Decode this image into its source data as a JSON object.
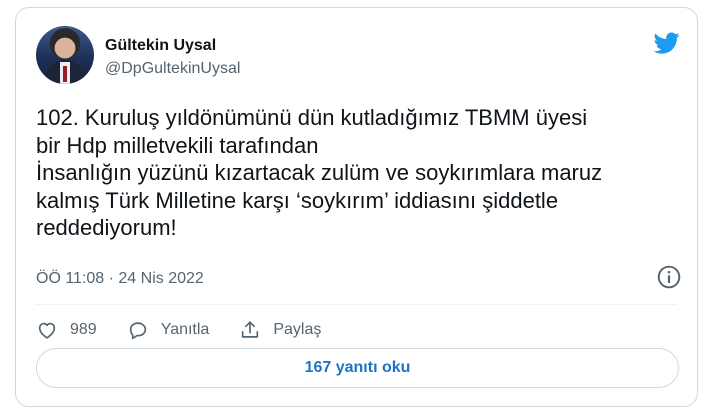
{
  "author": {
    "name": "Gültekin Uysal",
    "handle": "@DpGultekinUysal"
  },
  "tweet": {
    "text": "102. Kuruluş yıldönümünü dün kutladığımız TBMM üyesi\nbir Hdp milletvekili tarafından\nİnsanlığın yüzünü kızartacak zulüm ve soykırımlara maruz\nkalmış Türk Milletine karşı ‘soykırım’ iddiasını şiddetle\nreddediyorum!",
    "timestamp": "ÖÖ 11:08 · 24 Nis 2022"
  },
  "actions": {
    "like_count": "989",
    "reply_label": "Yanıtla",
    "share_label": "Paylaş"
  },
  "replies_button": {
    "label": "167 yanıtı oku"
  },
  "colors": {
    "twitter_blue": "#1d9bf0",
    "link_blue": "#1d73c8",
    "secondary_text": "#536471"
  },
  "icons": {
    "brand": "twitter-bird-icon",
    "info": "info-icon",
    "like": "heart-icon",
    "reply": "speech-bubble-icon",
    "share": "share-upload-icon"
  }
}
